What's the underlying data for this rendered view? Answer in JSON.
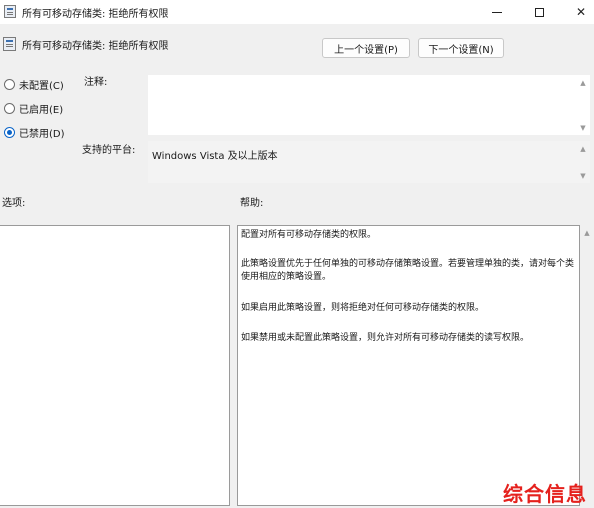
{
  "window": {
    "title": "所有可移动存储类: 拒绝所有权限",
    "icon": "policy-window-icon",
    "controls": {
      "minimize": "minimize-icon",
      "maximize": "maximize-icon",
      "close": "close-icon"
    }
  },
  "header": {
    "policy_name": "所有可移动存储类: 拒绝所有权限",
    "prev_button": "上一个设置(P)",
    "next_button": "下一个设置(N)"
  },
  "state": {
    "options": [
      {
        "label": "未配置(C)",
        "checked": false
      },
      {
        "label": "已启用(E)",
        "checked": false
      },
      {
        "label": "已禁用(D)",
        "checked": true
      }
    ]
  },
  "comment": {
    "label": "注释:",
    "value": ""
  },
  "platform": {
    "label": "支持的平台:",
    "value": "Windows Vista 及以上版本"
  },
  "options_section": {
    "label": "选项:"
  },
  "help_section": {
    "label": "帮助:",
    "paragraphs": [
      "配置对所有可移动存储类的权限。",
      "此策略设置优先于任何单独的可移动存储策略设置。若要管理单独的类，请对每个类使用相应的策略设置。",
      "如果启用此策略设置，则将拒绝对任何可移动存储类的权限。",
      "如果禁用或未配置此策略设置，则允许对所有可移动存储类的读写权限。"
    ]
  },
  "watermark": "综合信息",
  "colors": {
    "accent": "#0a64c8",
    "watermark": "#e5211d"
  }
}
